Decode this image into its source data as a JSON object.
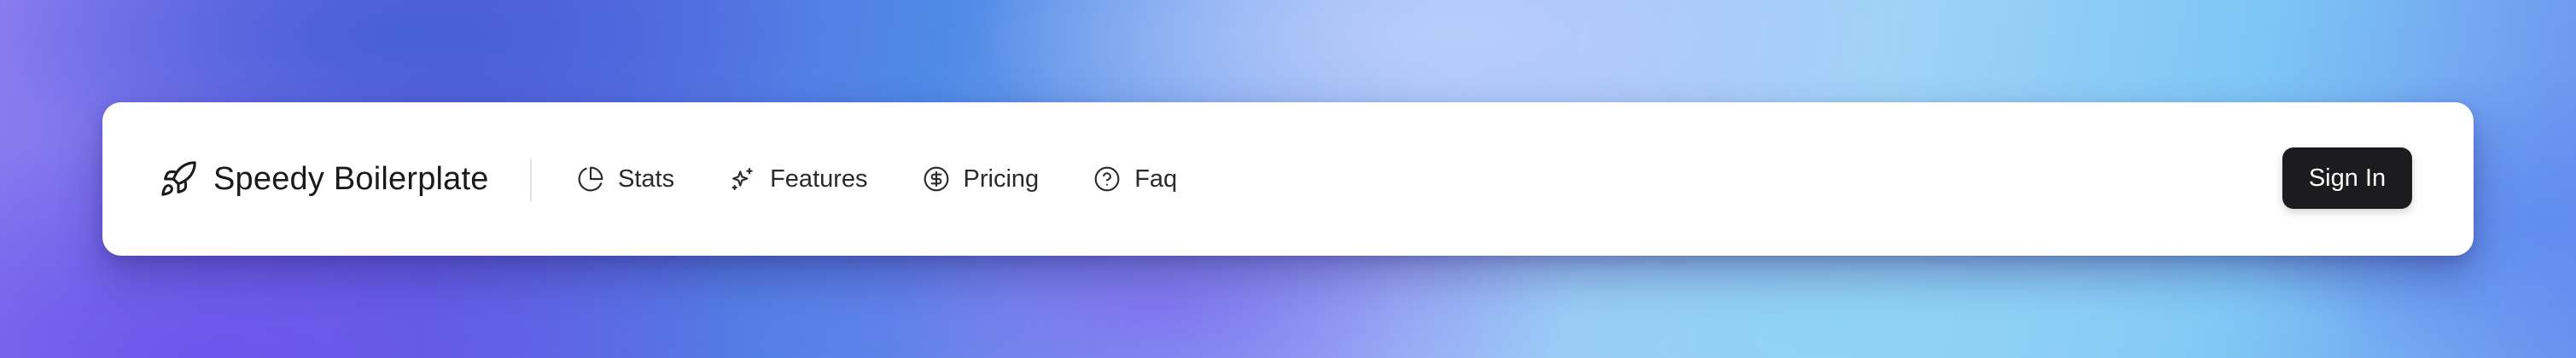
{
  "brand": {
    "name": "Speedy Boilerplate",
    "icon": "rocket-icon"
  },
  "nav": {
    "items": [
      {
        "label": "Stats",
        "icon": "pie-chart-icon"
      },
      {
        "label": "Features",
        "icon": "sparkles-icon"
      },
      {
        "label": "Pricing",
        "icon": "dollar-circle-icon"
      },
      {
        "label": "Faq",
        "icon": "help-circle-icon"
      }
    ]
  },
  "actions": {
    "sign_in_label": "Sign In"
  },
  "colors": {
    "navbar_bg": "#ffffff",
    "button_bg": "#1c1c1e",
    "button_text": "#ffffff",
    "text": "#1a1a1a"
  }
}
